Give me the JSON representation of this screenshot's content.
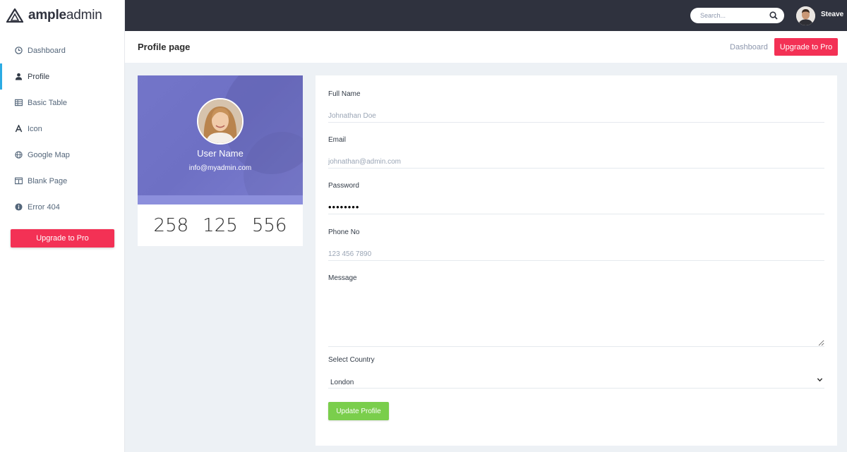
{
  "brand": {
    "bold": "ample",
    "light": "admin"
  },
  "sidebar": {
    "items": [
      {
        "label": "Dashboard",
        "icon": "clock-icon"
      },
      {
        "label": "Profile",
        "icon": "user-icon",
        "active": true
      },
      {
        "label": "Basic Table",
        "icon": "table-icon"
      },
      {
        "label": "Icon",
        "icon": "font-icon"
      },
      {
        "label": "Google Map",
        "icon": "globe-icon"
      },
      {
        "label": "Blank Page",
        "icon": "columns-icon"
      },
      {
        "label": "Error 404",
        "icon": "info-icon"
      }
    ],
    "upgrade_label": "Upgrade to Pro"
  },
  "topbar": {
    "search_placeholder": "Search...",
    "user_name": "Steave"
  },
  "header": {
    "title": "Profile page",
    "breadcrumb": "Dashboard",
    "upgrade_label": "Upgrade to Pro"
  },
  "profile": {
    "name": "User Name",
    "email": "info@myadmin.com",
    "stats": [
      "258",
      "125",
      "556"
    ]
  },
  "form": {
    "full_name": {
      "label": "Full Name",
      "placeholder": "Johnathan Doe"
    },
    "email": {
      "label": "Email",
      "placeholder": "johnathan@admin.com"
    },
    "password": {
      "label": "Password",
      "value": "password"
    },
    "phone": {
      "label": "Phone No",
      "placeholder": "123 456 7890"
    },
    "message": {
      "label": "Message"
    },
    "country": {
      "label": "Select Country",
      "value": "London"
    },
    "submit_label": "Update Profile"
  },
  "colors": {
    "accent": "#2cabe3",
    "danger": "#f33155",
    "success": "#7ace4c",
    "topbar": "#2f323e",
    "profile_banner": "#7375c9"
  }
}
